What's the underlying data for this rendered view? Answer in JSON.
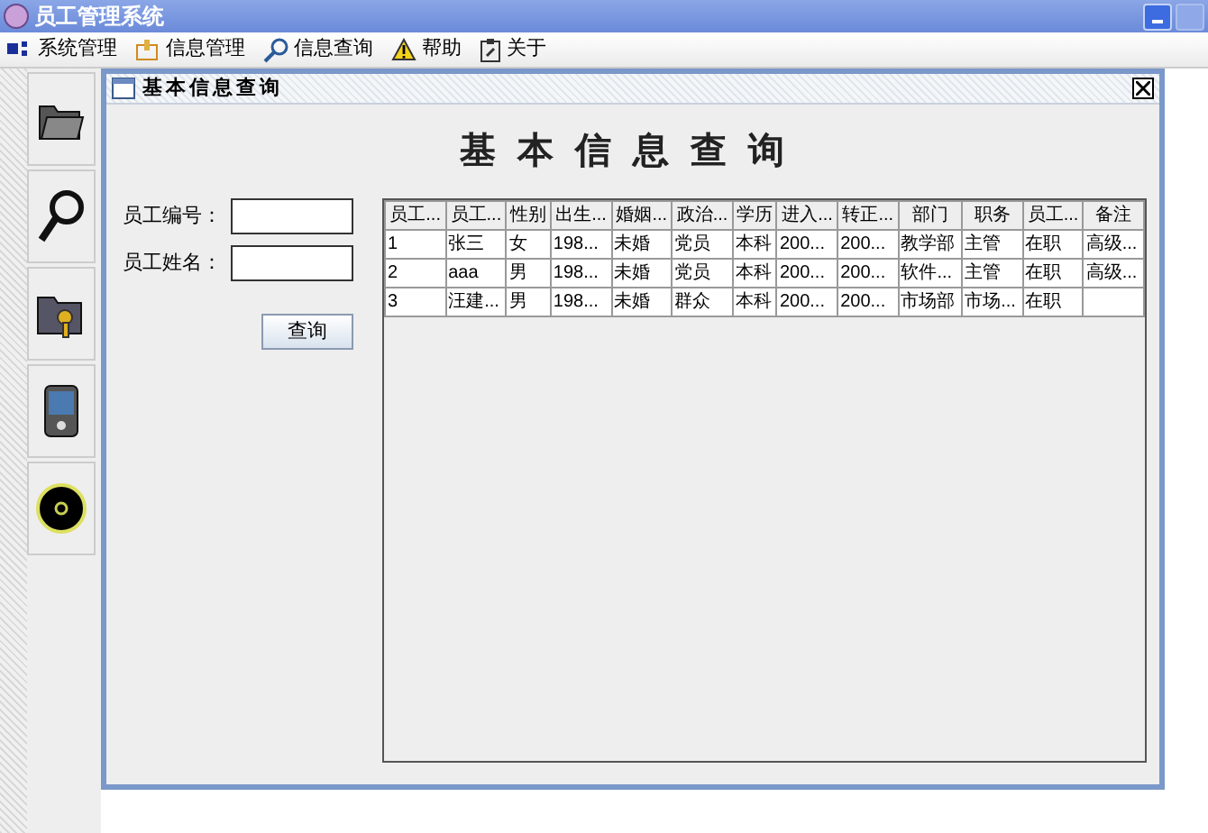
{
  "window": {
    "title": "员工管理系统"
  },
  "menu": [
    {
      "label": "系统管理"
    },
    {
      "label": "信息管理"
    },
    {
      "label": "信息查询"
    },
    {
      "label": "帮助"
    },
    {
      "label": "关于"
    }
  ],
  "frame": {
    "title": "基本信息查询",
    "heading": "基本信息查询"
  },
  "form": {
    "fields": [
      {
        "label": "员工编号："
      },
      {
        "label": "员工姓名："
      }
    ],
    "button": "查询"
  },
  "table": {
    "columns": [
      "员工...",
      "员工...",
      "性别",
      "出生...",
      "婚姻...",
      "政治...",
      "学历",
      "进入...",
      "转正...",
      "部门",
      "职务",
      "员工...",
      "备注"
    ],
    "rows": [
      [
        "1",
        "张三",
        "女",
        "198...",
        "未婚",
        "党员",
        "本科",
        "200...",
        "200...",
        "教学部",
        "主管",
        "在职",
        "高级..."
      ],
      [
        "2",
        "aaa",
        "男",
        "198...",
        "未婚",
        "党员",
        "本科",
        "200...",
        "200...",
        "软件...",
        "主管",
        "在职",
        "高级..."
      ],
      [
        "3",
        "汪建...",
        "男",
        "198...",
        "未婚",
        "群众",
        "本科",
        "200...",
        "200...",
        "市场部",
        "市场...",
        "在职",
        ""
      ]
    ]
  }
}
